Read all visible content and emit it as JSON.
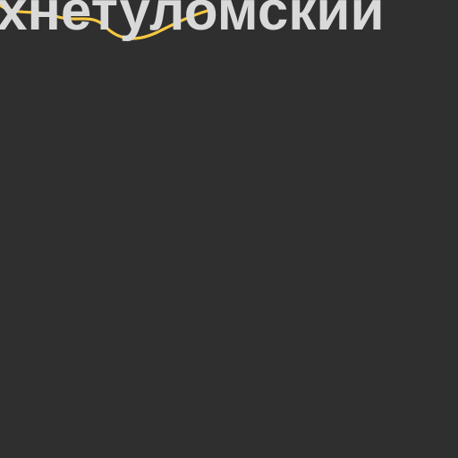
{
  "title": "хнетуломскии",
  "colors": {
    "background": "#2f2f2f",
    "text": "#d9d9d9",
    "route": "#f5c842"
  }
}
